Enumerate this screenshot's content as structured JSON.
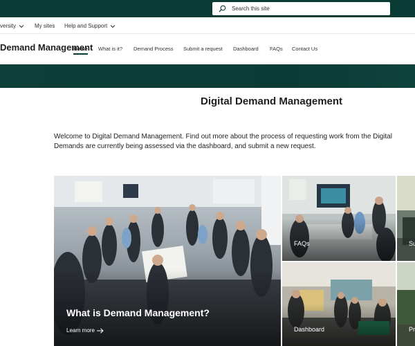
{
  "suitebar": {
    "search_placeholder": "Search this site",
    "search_icon": "search-icon"
  },
  "hubnav": {
    "items": [
      {
        "label": "University",
        "has_dropdown": true
      },
      {
        "label": "My sites",
        "has_dropdown": false
      },
      {
        "label": "Help and Support",
        "has_dropdown": true
      }
    ]
  },
  "site": {
    "title": "Demand Management",
    "nav": [
      {
        "label": "Home",
        "active": true
      },
      {
        "label": "What is it?"
      },
      {
        "label": "Demand Process"
      },
      {
        "label": "Submit a request"
      },
      {
        "label": "Dashboard"
      },
      {
        "label": "FAQs"
      },
      {
        "label": "Contact Us"
      }
    ]
  },
  "page": {
    "title": "Digital Demand Management",
    "intro_line1": "Welcome to Digital Demand Management. Find out more about the process of requesting work from the Digital",
    "intro_line2": "Demands are currently being assessed via the dashboard, and submit a new request."
  },
  "tiles": {
    "main": {
      "title": "What is Demand Management?",
      "link": "Learn more"
    },
    "faqs": {
      "label": "FAQs"
    },
    "sub": {
      "label": "Su"
    },
    "dashboard": {
      "label": "Dashboard"
    },
    "pr": {
      "label": "Pr"
    }
  },
  "colors": {
    "brand": "#0b3b35",
    "text": "#201f1e"
  }
}
